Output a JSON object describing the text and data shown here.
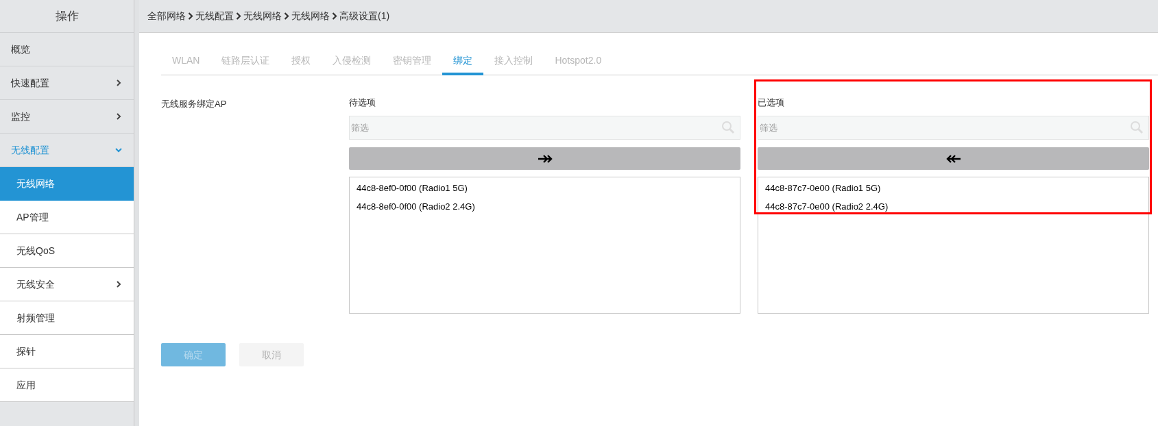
{
  "sidebar": {
    "title": "操作",
    "items": [
      {
        "label": "概览",
        "selected": false
      },
      {
        "label": "快速配置",
        "selected": false,
        "expanded": false
      },
      {
        "label": "监控",
        "selected": false,
        "expanded": false
      },
      {
        "label": "无线配置",
        "selected": false,
        "expanded": true,
        "children": [
          {
            "label": "无线网络",
            "selected": true
          },
          {
            "label": "AP管理",
            "selected": false
          },
          {
            "label": "无线QoS",
            "selected": false
          },
          {
            "label": "无线安全",
            "selected": false,
            "expanded": false
          },
          {
            "label": "射频管理",
            "selected": false
          },
          {
            "label": "探针",
            "selected": false
          },
          {
            "label": "应用",
            "selected": false
          }
        ]
      }
    ]
  },
  "breadcrumb": [
    "全部网络",
    "无线配置",
    "无线网络",
    "无线网络",
    "高级设置(1)"
  ],
  "tabs": [
    {
      "label": "WLAN",
      "selected": false
    },
    {
      "label": "链路层认证",
      "selected": false
    },
    {
      "label": "授权",
      "selected": false
    },
    {
      "label": "入侵检测",
      "selected": false
    },
    {
      "label": "密钥管理",
      "selected": false
    },
    {
      "label": "绑定",
      "selected": true
    },
    {
      "label": "接入控制",
      "selected": false
    },
    {
      "label": "Hotspot2.0",
      "selected": false
    }
  ],
  "form": {
    "label": "无线服务绑定AP",
    "panels": [
      {
        "title": "待选项",
        "filter_placeholder": "筛选",
        "kind": "add",
        "highlighted": false,
        "items": [
          "44c8-8ef0-0f00 (Radio1 5G)",
          "44c8-8ef0-0f00 (Radio2 2.4G)"
        ]
      },
      {
        "title": "已选项",
        "filter_placeholder": "筛选",
        "kind": "remove",
        "highlighted": true,
        "items": [
          "44c8-87c7-0e00 (Radio1 5G)",
          "44c8-87c7-0e00 (Radio2 2.4G)"
        ]
      }
    ]
  },
  "buttons": [
    {
      "label": "确定",
      "kind": "primary",
      "disabled": true
    },
    {
      "label": "取消",
      "kind": "secondary",
      "disabled": true
    }
  ]
}
